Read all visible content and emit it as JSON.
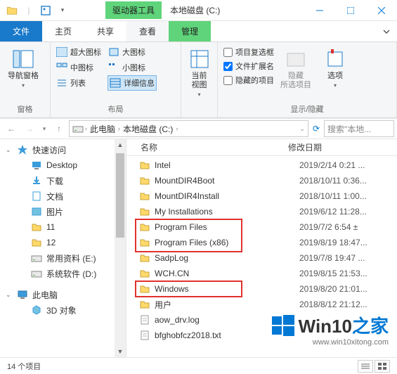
{
  "titlebar": {
    "context_label": "驱动器工具",
    "title": "本地磁盘 (C:)"
  },
  "tabs": {
    "file": "文件",
    "home": "主页",
    "share": "共享",
    "view": "查看",
    "manage": "管理"
  },
  "ribbon": {
    "nav_pane": "导航窗格",
    "group_panes": "窗格",
    "layout_items": [
      "超大图标",
      "大图标",
      "中图标",
      "小图标",
      "列表",
      "详细信息"
    ],
    "group_layout": "布局",
    "current_view": "当前\n视图",
    "check_dup": "项目复选框",
    "check_ext": "文件扩展名",
    "check_hidden": "隐藏的项目",
    "hide_selected": "隐藏\n所选项目",
    "group_showhide": "显示/隐藏",
    "options": "选项"
  },
  "breadcrumb": {
    "pc": "此电脑",
    "drive": "本地磁盘 (C:)"
  },
  "search_placeholder": "搜索\"本地...",
  "columns": {
    "name": "名称",
    "date": "修改日期"
  },
  "sidebar": {
    "quick": "快速访问",
    "items": [
      {
        "label": "Desktop",
        "icon": "desktop"
      },
      {
        "label": "下载",
        "icon": "downloads"
      },
      {
        "label": "文档",
        "icon": "documents"
      },
      {
        "label": "图片",
        "icon": "pictures"
      },
      {
        "label": "11",
        "icon": "folder"
      },
      {
        "label": "12",
        "icon": "folder"
      },
      {
        "label": "常用资料 (E:)",
        "icon": "drive"
      },
      {
        "label": "系统软件 (D:)",
        "icon": "drive"
      }
    ],
    "thispc": "此电脑",
    "thispc_items": [
      {
        "label": "3D 对象",
        "icon": "3d"
      }
    ]
  },
  "files": [
    {
      "name": "Intel",
      "type": "folder",
      "date": "2019/2/14 0:21 ..."
    },
    {
      "name": "MountDIR4Boot",
      "type": "folder",
      "date": "2018/10/11 0:36..."
    },
    {
      "name": "MountDIR4Install",
      "type": "folder",
      "date": "2018/10/11 1:00..."
    },
    {
      "name": "My Installations",
      "type": "folder",
      "date": "2019/6/12 11:28..."
    },
    {
      "name": "Program Files",
      "type": "folder",
      "date": "2019/7/2 6:54 ±"
    },
    {
      "name": "Program Files (x86)",
      "type": "folder",
      "date": "2019/8/19 18:47..."
    },
    {
      "name": "SadpLog",
      "type": "folder",
      "date": "2019/7/8 19:47 ..."
    },
    {
      "name": "WCH.CN",
      "type": "folder",
      "date": "2019/8/15 21:53..."
    },
    {
      "name": "Windows",
      "type": "folder",
      "date": "2019/8/20 21:01..."
    },
    {
      "name": "用户",
      "type": "folder",
      "date": "2018/8/12 21:12..."
    },
    {
      "name": "aow_drv.log",
      "type": "file",
      "date": ""
    },
    {
      "name": "bfghobfcz2018.txt",
      "type": "file",
      "date": ""
    }
  ],
  "status": "14 个项目",
  "watermark": {
    "brand": "Win10",
    "suffix": "之家",
    "url": "www.win10xitong.com"
  }
}
